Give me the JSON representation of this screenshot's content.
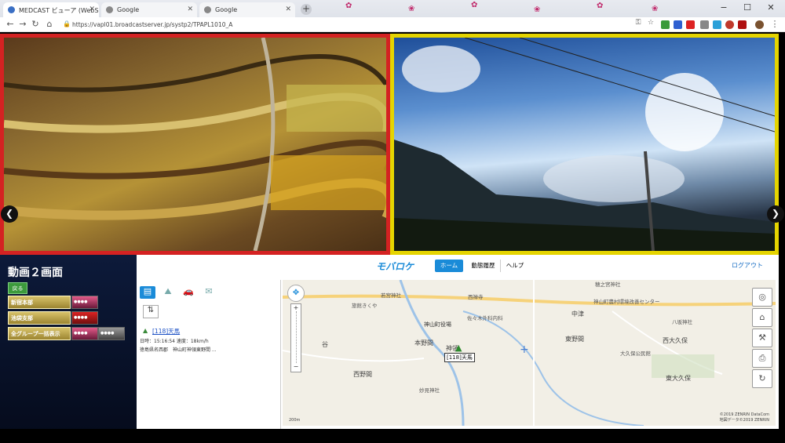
{
  "browser": {
    "tabs": [
      {
        "title": "MEDCAST ビューア (WebSocket)",
        "active": true
      },
      {
        "title": "Google",
        "active": false
      },
      {
        "title": "Google",
        "active": false
      }
    ],
    "new_tab": "+",
    "url": "https://vapl01.broadcastserver.jp/systp2/TPAPL1010_A",
    "window_controls": {
      "minimize": "−",
      "maximize": "☐",
      "close": "✕"
    }
  },
  "left_panel": {
    "title": "動画２画面",
    "back_button": "戻る",
    "groups": [
      {
        "label": "新宿本部",
        "cells": [
          "pink"
        ]
      },
      {
        "label": "池袋支部",
        "cells": [
          "red"
        ]
      },
      {
        "label": "全グループ一括表示",
        "cells": [
          "pink",
          "gray"
        ]
      }
    ]
  },
  "header": {
    "logo": "モバロケ",
    "tabs": [
      {
        "label": "ホーム",
        "active": true
      },
      {
        "label": "動態履歴",
        "active": false
      },
      {
        "label": "ヘルプ",
        "active": false
      }
    ],
    "logout": "ログアウト"
  },
  "vehicle": {
    "name": "[118]天馬",
    "time_line": "日時：15:16:54  速度：18km/h",
    "addr_line": "徳島県名西郡　神山町神領東野間 ..."
  },
  "map": {
    "labels": [
      "神山町役場",
      "本野間",
      "西野間",
      "神領",
      "東野間",
      "中津",
      "西大久保",
      "東大久保",
      "谷",
      "若宮神社",
      "旅館きくや",
      "佐々木外科内科",
      "妙見神社",
      "西禅寺",
      "八坂神社",
      "大久保公民館",
      "神山町農村環境改善センター",
      "穂之宮神社"
    ],
    "car_label": "[118]天馬",
    "scale": "200m",
    "copyright": "©2019 ZENRIN DataCom\n地図データ©2019 ZENRIN"
  },
  "colors": {
    "video1_border": "#d42222",
    "video2_border": "#e5d400",
    "accent": "#1a8bd8"
  }
}
